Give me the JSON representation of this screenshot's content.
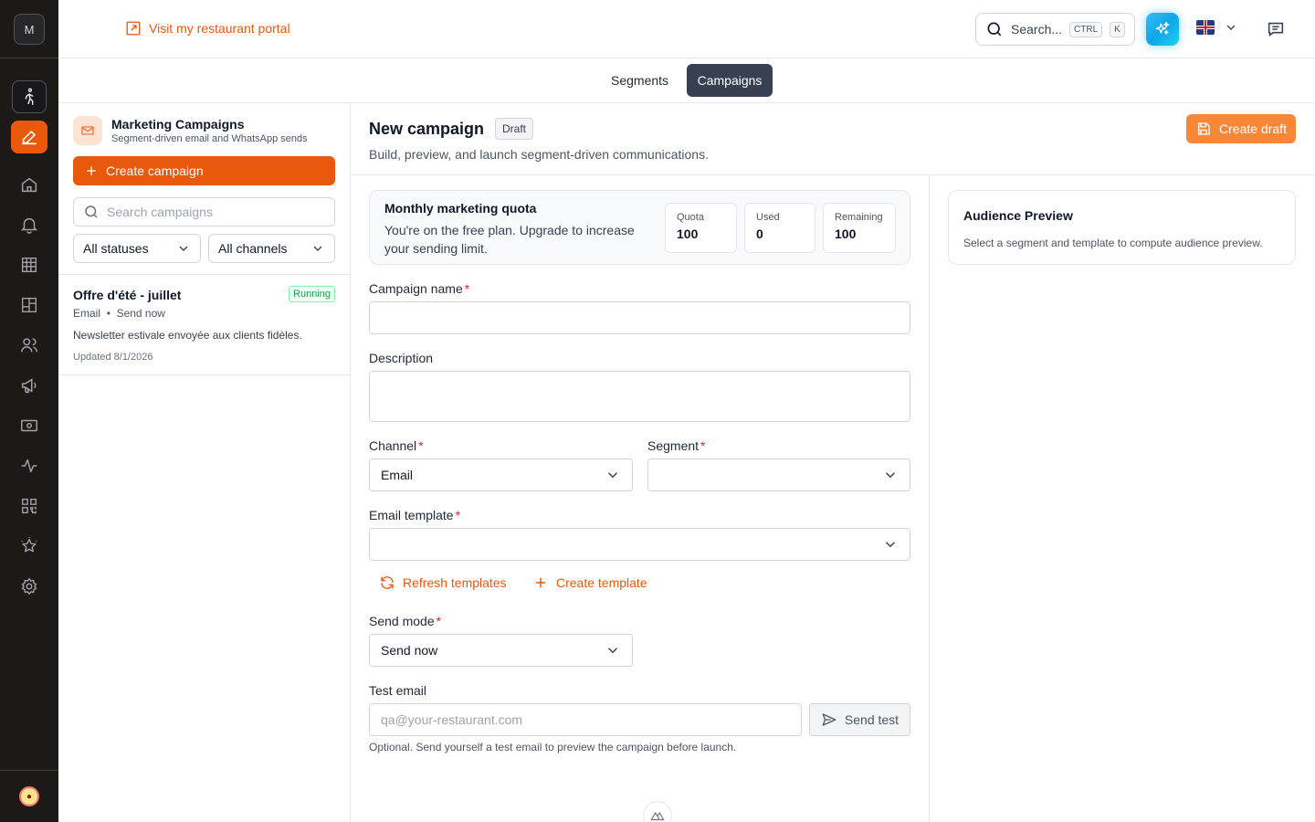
{
  "brand": {
    "initial": "M"
  },
  "rail": {
    "items": [
      {
        "name": "walk-icon"
      },
      {
        "name": "edit-icon",
        "active": true
      },
      {
        "name": "home-icon"
      },
      {
        "name": "bell-icon"
      },
      {
        "name": "grid-icon"
      },
      {
        "name": "layout-icon"
      },
      {
        "name": "users-icon"
      },
      {
        "name": "megaphone-icon"
      },
      {
        "name": "cash-icon"
      },
      {
        "name": "activity-icon"
      },
      {
        "name": "qr-code-icon"
      },
      {
        "name": "star-icon"
      },
      {
        "name": "settings-icon"
      }
    ]
  },
  "topbar": {
    "portal_link": "Visit my restaurant portal",
    "search_label": "Search...",
    "kbd_ctrl": "CTRL",
    "kbd_k": "K",
    "language": "English (UK)"
  },
  "tabs": {
    "segments": "Segments",
    "campaigns": "Campaigns",
    "active": "Campaigns"
  },
  "list_panel": {
    "title": "Marketing Campaigns",
    "subtitle": "Segment-driven email and WhatsApp sends",
    "create_button": "Create campaign",
    "search_placeholder": "Search campaigns",
    "status_filter": "All statuses",
    "channel_filter": "All channels",
    "campaigns": [
      {
        "title": "Offre d'été - juillet",
        "status": "Running",
        "channel": "Email",
        "mode": "Send now",
        "separator": "•",
        "description": "Newsletter estivale envoyée aux clients fidèles.",
        "updated": "Updated 8/1/2026"
      }
    ]
  },
  "main": {
    "title": "New campaign",
    "badge": "Draft",
    "subtitle": "Build, preview, and launch segment-driven communications.",
    "create_draft": "Create draft"
  },
  "quota": {
    "title": "Monthly marketing quota",
    "text": "You're on the free plan. Upgrade to increase your sending limit.",
    "quota_label": "Quota",
    "quota_value": "100",
    "used_label": "Used",
    "used_value": "0",
    "remaining_label": "Remaining",
    "remaining_value": "100"
  },
  "form": {
    "name_label": "Campaign name",
    "name_value": "",
    "description_label": "Description",
    "description_value": "",
    "channel_label": "Channel",
    "channel_value": "Email",
    "segment_label": "Segment",
    "segment_value": "",
    "template_label": "Email template",
    "template_value": "",
    "refresh_templates": "Refresh templates",
    "create_template": "Create template",
    "send_mode_label": "Send mode",
    "send_mode_value": "Send now",
    "test_email_label": "Test email",
    "test_email_placeholder": "qa@your-restaurant.com",
    "send_test": "Send test",
    "help": "Optional. Send yourself a test email to preview the campaign before launch.",
    "required_mark": "*"
  },
  "preview": {
    "title": "Audience Preview",
    "text": "Select a segment and template to compute audience preview."
  },
  "colors": {
    "accent": "#ea580c",
    "rail": "#1c1917",
    "tab_active": "#374151",
    "running": "#16a34a"
  }
}
